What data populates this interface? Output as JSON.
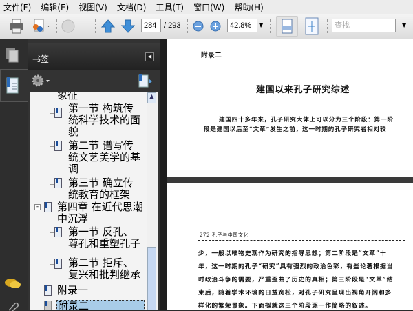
{
  "menu": [
    "文件(F)",
    "编辑(E)",
    "视图(V)",
    "文档(D)",
    "工具(T)",
    "窗口(W)",
    "帮助(H)"
  ],
  "toolbar": {
    "current_page": "284",
    "total_pages": "/ 293",
    "zoom": "42.8%",
    "search_placeholder": "查找"
  },
  "panel": {
    "title": "书签"
  },
  "bookmarks": [
    {
      "label": "象征",
      "level": 1
    },
    {
      "label": "第一节  构筑传统科学技术的面貌",
      "lines": [
        "第一节  构筑传",
        "统科学技术的面",
        "貌"
      ]
    },
    {
      "label": "第二节  谱写传统文艺美学的基调",
      "lines": [
        "第二节  谱写传",
        "统文艺美学的基",
        "调"
      ]
    },
    {
      "label": "第三节  确立传统教育的框架",
      "lines": [
        "第三节  确立传",
        "统教育的框架"
      ]
    },
    {
      "label": "第四章  在近代思潮中沉浮",
      "lines": [
        "第四章  在近代思潮",
        "中沉浮"
      ]
    },
    {
      "label": "第一节  反孔、尊孔和重塑孔子",
      "lines": [
        "第一节  反孔、",
        "尊孔和重塑孔子"
      ]
    },
    {
      "label": "第二节  拒斥、复兴和批判继承",
      "lines": [
        "第二节  拒斥、",
        "复兴和批判继承"
      ]
    },
    {
      "label": "附录一"
    },
    {
      "label": "附录二",
      "selected": true
    }
  ],
  "document": {
    "page1": {
      "header": "附录二",
      "title": "建国以来孔子研究综述",
      "lines": [
        "建国四十多年来，孔子研究大体上可以分为三个阶段：第一阶",
        "段是建国以后至“文革”发生之前，这一时期的孔子研究者相对较"
      ]
    },
    "page2": {
      "running_head": "272  孔子与中国文化",
      "lines": [
        "少，一般以唯物史观作为研究的指导思想；第二阶段是“文革”十",
        "年，这一时期的孔子“研究”具有强烈的政治色彩，有些论著根据当",
        "时政治斗争的需要，严重歪曲了历史的真相；第三阶段是“文革”结",
        "束后，随着学术环境的日益宽松，对孔子研究呈现出视角开阔和多",
        "样化的繁荣景象。下面拟就这三个阶段逐一作简略的叙述。"
      ]
    }
  }
}
